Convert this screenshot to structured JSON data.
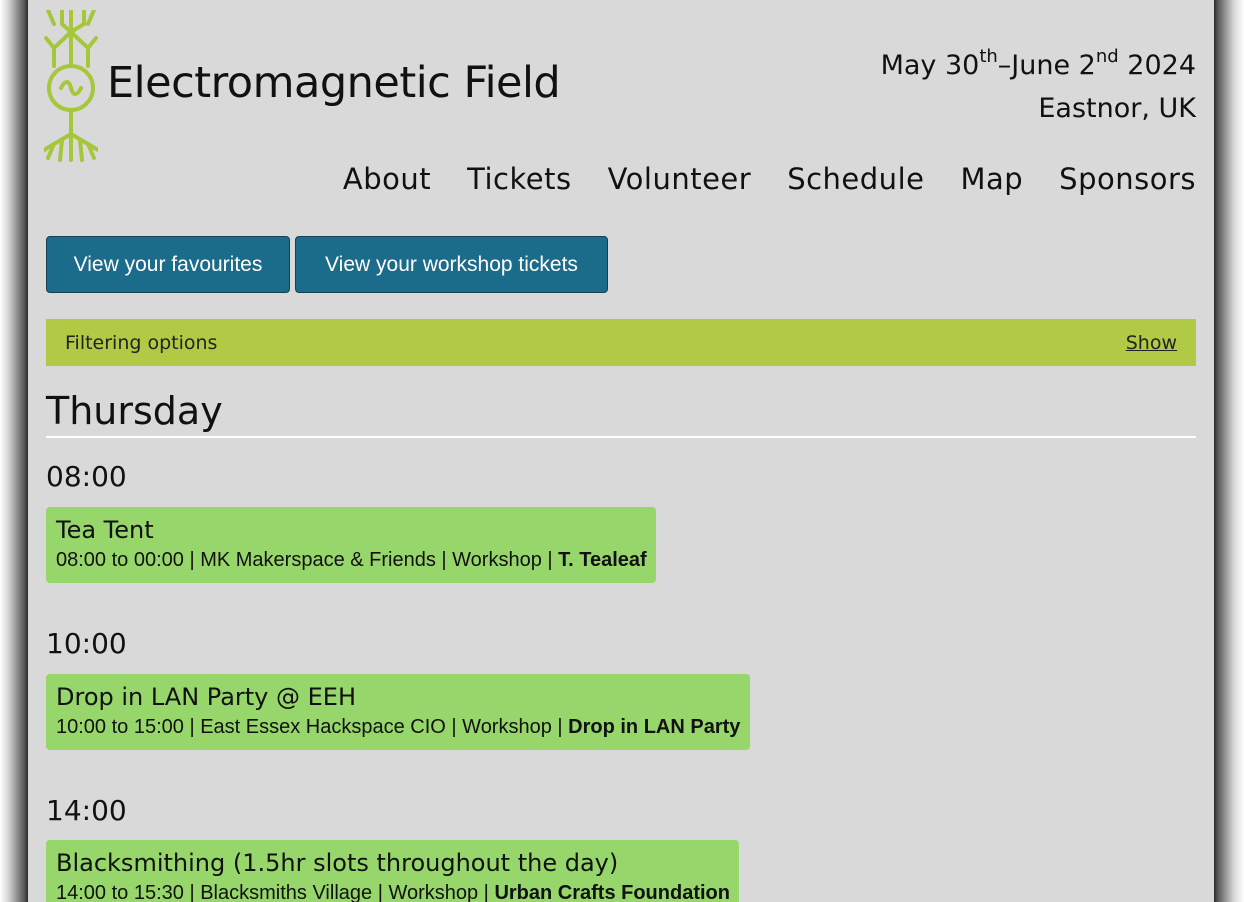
{
  "site": {
    "title": "Electromagnetic Field",
    "dates": {
      "start_prefix": "May 30",
      "start_suffix": "th",
      "separator": "–June 2",
      "end_suffix": "nd",
      "year": " 2024"
    },
    "location": "Eastnor, UK",
    "logo_icon": "emf-tree-logo-icon",
    "accent_color": "#a6c63b"
  },
  "nav": {
    "items": [
      {
        "label": "About"
      },
      {
        "label": "Tickets"
      },
      {
        "label": "Volunteer"
      },
      {
        "label": "Schedule"
      },
      {
        "label": "Map"
      },
      {
        "label": "Sponsors"
      }
    ]
  },
  "actions": {
    "favourites_label": "View your favourites",
    "workshop_tickets_label": "View your workshop tickets",
    "button_color": "#1b6b8a"
  },
  "filter": {
    "label": "Filtering options",
    "toggle_label": "Show",
    "bar_color": "#b0ca45"
  },
  "schedule": {
    "day": "Thursday",
    "slots": [
      {
        "time": "08:00",
        "events": [
          {
            "title": "Tea Tent",
            "times": "08:00 to 00:00",
            "venue": "MK Makerspace & Friends",
            "type": "Workshop",
            "host": "T. Tealeaf"
          }
        ]
      },
      {
        "time": "10:00",
        "events": [
          {
            "title": "Drop in LAN Party @ EEH",
            "times": "10:00 to 15:00",
            "venue": "East Essex Hackspace CIO",
            "type": "Workshop",
            "host": "Drop in LAN Party"
          }
        ]
      },
      {
        "time": "14:00",
        "events": [
          {
            "title": "Blacksmithing (1.5hr slots throughout the day)",
            "times": "14:00 to 15:30",
            "venue": "Blacksmiths Village",
            "type": "Workshop",
            "host": "Urban Crafts Foundation"
          }
        ]
      }
    ],
    "card_color": "#96d66a"
  },
  "separator": " | "
}
